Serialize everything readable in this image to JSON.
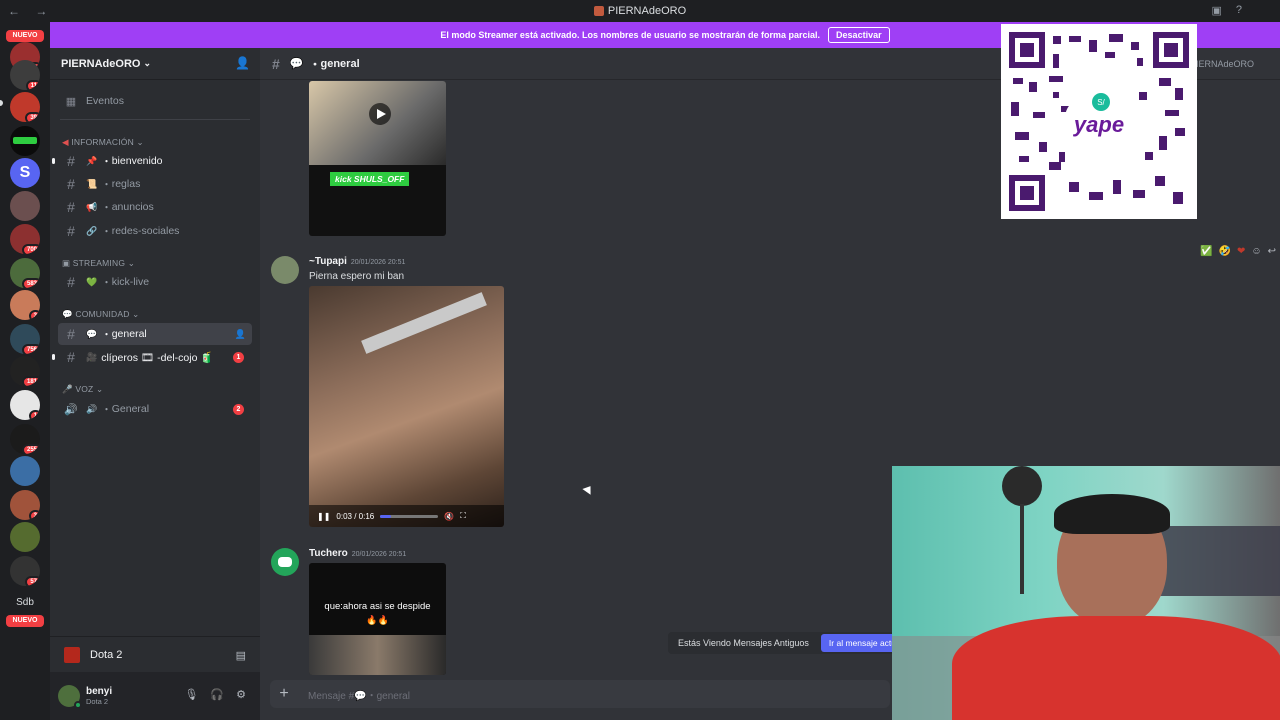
{
  "window": {
    "title": "PIERNAdeORO"
  },
  "banner": {
    "text": "El modo Streamer está activado. Los nombres de usuario se mostrarán de forma parcial.",
    "button": "Desactivar"
  },
  "guilds": {
    "nuevo_label": "NUEVO",
    "sdb_label": "Sdb",
    "badges": [
      "19",
      "11",
      "39",
      "",
      "",
      "",
      "700",
      "583",
      "3",
      "756",
      "181",
      "1",
      "255",
      "",
      "3",
      "",
      "57"
    ]
  },
  "server": {
    "name": "PIERNAdeORO",
    "dropdown_glyph": "⌄"
  },
  "sidebar": {
    "events_label": "Eventos",
    "categories": [
      {
        "label": "INFORMACIÓN"
      },
      {
        "label": "STREAMING"
      },
      {
        "label": "COMUNIDAD"
      },
      {
        "label": "VOZ"
      }
    ],
    "channels": [
      {
        "label": "bienvenido",
        "emoji": "📌"
      },
      {
        "label": "reglas",
        "emoji": "📜"
      },
      {
        "label": "anuncios",
        "emoji": "📢"
      },
      {
        "label": "redes-sociales",
        "emoji": "🔗"
      },
      {
        "label": "kick-live",
        "emoji": "💚"
      },
      {
        "label": "general",
        "emoji": "💬"
      },
      {
        "label": "clíperos 🎞 -del-cojo 🧃",
        "emoji": "🎥",
        "badge": "1"
      },
      {
        "label": "General",
        "emoji": "🔊",
        "badge": "2"
      }
    ],
    "voice_activity": "Dota 2"
  },
  "user": {
    "name": "benyi",
    "status": "Dota 2"
  },
  "chat": {
    "channel_name": "general",
    "channel_emoji": "💬",
    "header_user": "PIERNAdeORO",
    "messages": [
      {
        "author": "~Tupapi",
        "time": "20/01/2026 20:51",
        "text": "Pierna espero mi ban",
        "video_time": "0:03 / 0:16",
        "video_progress": 0.19
      },
      {
        "author": "Tuchero",
        "time": "20/01/2026 20:51",
        "video_caption": "que:ahora asi se despide",
        "video_emoji": "🔥🔥"
      }
    ],
    "prev_video_caption": "kick SHULS_OFF",
    "jump_text": "Estás Viendo Mensajes Antiguos",
    "jump_button": "Ir al mensaje actual",
    "composer_placeholder": "Mensaje #💬・general"
  },
  "overlay": {
    "qr_brand": "yape",
    "qr_symbol": "S/"
  },
  "colors": {
    "accent": "#5865f2",
    "banner": "#9f3ff5",
    "danger": "#f23f43",
    "online": "#23a55a"
  }
}
